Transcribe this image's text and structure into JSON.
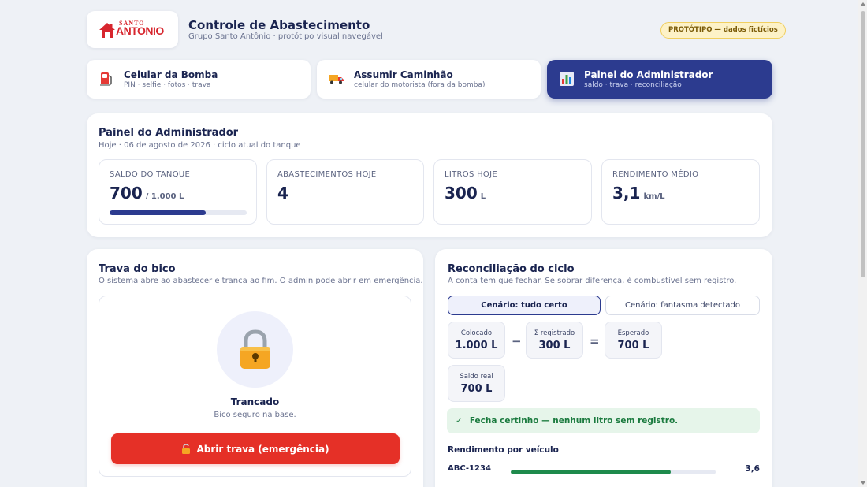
{
  "header": {
    "logo_top": "SANTO",
    "logo_main": "ANTONIO",
    "title": "Controle de Abastecimento",
    "subtitle": "Grupo Santo Antônio · protótipo visual navegável",
    "badge": "PROTÓTIPO — dados fictícios"
  },
  "tabs": [
    {
      "label": "Celular da Bomba",
      "sub": "PIN · selfie · fotos · trava",
      "icon": "fuel-pump-icon",
      "active": false
    },
    {
      "label": "Assumir Caminhão",
      "sub": "celular do motorista (fora da bomba)",
      "icon": "truck-icon",
      "active": false
    },
    {
      "label": "Painel do Administrador",
      "sub": "saldo · trava · reconciliação",
      "icon": "bar-chart-icon",
      "active": true
    }
  ],
  "admin": {
    "title": "Painel do Administrador",
    "subtitle": "Hoje · 06 de agosto de 2026 · ciclo atual do tanque",
    "stats": [
      {
        "label": "SALDO DO TANQUE",
        "value": "700",
        "unit": "/ 1.000 L",
        "progress": 0.7
      },
      {
        "label": "ABASTECIMENTOS HOJE",
        "value": "4",
        "unit": ""
      },
      {
        "label": "LITROS HOJE",
        "value": "300",
        "unit": "L"
      },
      {
        "label": "RENDIMENTO MÉDIO",
        "value": "3,1",
        "unit": "km/L"
      }
    ]
  },
  "lock": {
    "title": "Trava do bico",
    "subtitle": "O sistema abre ao abastecer e tranca ao fim. O admin pode abrir em emergência.",
    "icon": "padlock-icon",
    "state": "Trancado",
    "state_desc": "Bico seguro na base.",
    "button_icon": "open-padlock-icon",
    "button": "Abrir trava (emergência)"
  },
  "reconciliation": {
    "title": "Reconciliação do ciclo",
    "subtitle": "A conta tem que fechar. Se sobrar diferença, é combustível sem registro.",
    "scenarios": [
      {
        "label": "Cenário: tudo certo",
        "active": true
      },
      {
        "label": "Cenário: fantasma detectado",
        "active": false
      }
    ],
    "boxes": {
      "colocado": {
        "label": "Colocado",
        "value": "1.000 L"
      },
      "registrado": {
        "label": "Σ registrado",
        "value": "300 L"
      },
      "esperado": {
        "label": "Esperado",
        "value": "700 L"
      },
      "saldo_real": {
        "label": "Saldo real",
        "value": "700 L"
      }
    },
    "op_minus": "−",
    "op_equals": "=",
    "banner_icon": "check-icon",
    "banner_check": "✓",
    "banner": "Fecha certinho — nenhum litro sem registro.",
    "vehicles_title": "Rendimento por veículo",
    "vehicles": [
      {
        "plate": "ABC-1234",
        "value": "3,6",
        "fraction": 0.78
      }
    ]
  },
  "colors": {
    "primary": "#2c3b8f",
    "danger": "#e53027",
    "success": "#1e8a4c",
    "brand_red": "#d7262e"
  }
}
